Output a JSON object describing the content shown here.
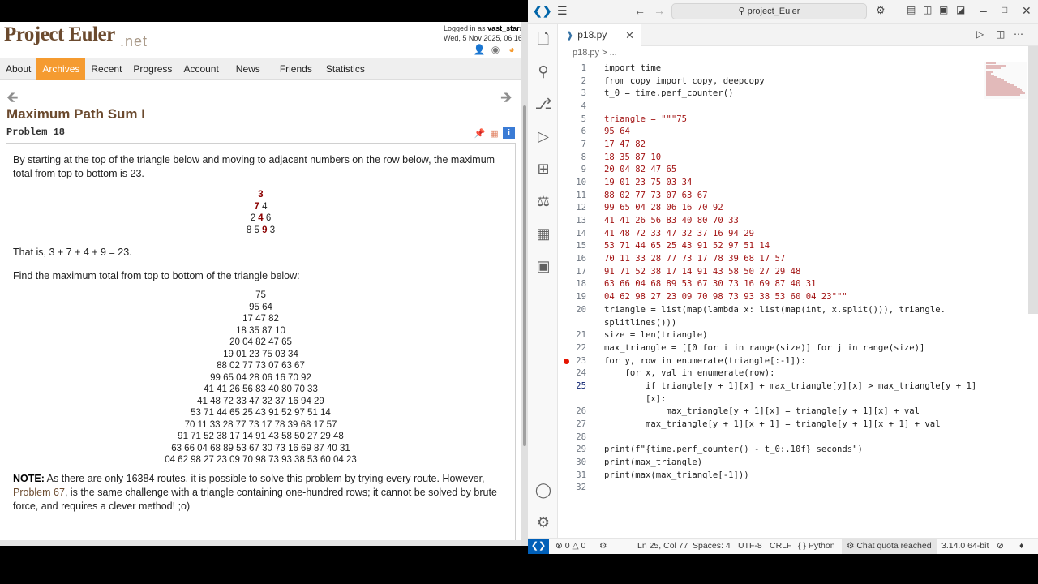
{
  "browser": {
    "logo": "Project Euler",
    "logo_suffix": ".net",
    "login_prefix": "Logged in as",
    "username": "vast_stars",
    "date": "Wed, 5 Nov 2025, 06:16",
    "nav": [
      "About",
      "Archives",
      "Recent",
      "Progress",
      "Account",
      "News",
      "Friends",
      "Statistics"
    ],
    "problem_title": "Maximum Path Sum I",
    "problem_number": "Problem 18",
    "intro": "By starting at the top of the triangle below and moving to adjacent numbers on the row below, the maximum total from top to bottom is 23.",
    "small_triangle": {
      "row1": "3",
      "row2_bold": "7",
      "row2_rest": " 4",
      "row3_a": "2 ",
      "row3_bold": "4",
      "row3_b": " 6",
      "row4_a": "8 5 ",
      "row4_bold": "9",
      "row4_b": " 3"
    },
    "that_is": "That is, 3 + 7 + 4 + 9 = 23.",
    "find_max": "Find the maximum total from top to bottom of the triangle below:",
    "big_triangle": [
      "75",
      "95 64",
      "17 47 82",
      "18 35 87 10",
      "20 04 82 47 65",
      "19 01 23 75 03 34",
      "88 02 77 73 07 63 67",
      "99 65 04 28 06 16 70 92",
      "41 41 26 56 83 40 80 70 33",
      "41 48 72 33 47 32 37 16 94 29",
      "53 71 44 65 25 43 91 52 97 51 14",
      "70 11 33 28 77 73 17 78 39 68 17 57",
      "91 71 52 38 17 14 91 43 58 50 27 29 48",
      "63 66 04 68 89 53 67 30 73 16 69 87 40 31",
      "04 62 98 27 23 09 70 98 73 93 38 53 60 04 23"
    ],
    "note_label": "NOTE:",
    "note_a": " As there are only 16384 routes, it is possible to solve this problem by trying every route. However, ",
    "note_link": "Problem 67",
    "note_b": ", is the same challenge with a triangle containing one-hundred rows; it cannot be solved by brute force, and requires a clever method! ;o)"
  },
  "vscode": {
    "search": "project_Euler",
    "tab": "p18.py",
    "tab_icon": "python-file-icon",
    "breadcrumb": "p18.py > ...",
    "lines": [
      {
        "n": "1"
      },
      {
        "n": "2"
      },
      {
        "n": "3"
      },
      {
        "n": "4"
      },
      {
        "n": "5"
      },
      {
        "n": "6"
      },
      {
        "n": "7"
      },
      {
        "n": "8"
      },
      {
        "n": "9"
      },
      {
        "n": "10"
      },
      {
        "n": "11"
      },
      {
        "n": "12"
      },
      {
        "n": "13"
      },
      {
        "n": "14"
      },
      {
        "n": "15"
      },
      {
        "n": "16"
      },
      {
        "n": "17"
      },
      {
        "n": "18"
      },
      {
        "n": "19"
      },
      {
        "n": "20"
      },
      {
        "n": "21"
      },
      {
        "n": "22"
      },
      {
        "n": "23"
      },
      {
        "n": "24"
      },
      {
        "n": "25"
      },
      {
        "n": "26"
      },
      {
        "n": "27"
      },
      {
        "n": "28"
      },
      {
        "n": "29"
      },
      {
        "n": "30"
      },
      {
        "n": "31"
      },
      {
        "n": "32"
      }
    ],
    "code": {
      "l1": "import time",
      "l2": "from copy import copy, deepcopy",
      "l3": "t_0 = time.perf_counter()",
      "l5": "triangle = \"\"\"75",
      "l6": "95 64",
      "l7": "17 47 82",
      "l8": "18 35 87 10",
      "l9": "20 04 82 47 65",
      "l10": "19 01 23 75 03 34",
      "l11": "88 02 77 73 07 63 67",
      "l12": "99 65 04 28 06 16 70 92",
      "l13": "41 41 26 56 83 40 80 70 33",
      "l14": "41 48 72 33 47 32 37 16 94 29",
      "l15": "53 71 44 65 25 43 91 52 97 51 14",
      "l16": "70 11 33 28 77 73 17 78 39 68 17 57",
      "l17": "91 71 52 38 17 14 91 43 58 50 27 29 48",
      "l18": "63 66 04 68 89 53 67 30 73 16 69 87 40 31",
      "l19": "04 62 98 27 23 09 70 98 73 93 38 53 60 04 23\"\"\"",
      "l20a": "triangle = list(map(lambda x: list(map(int, x.split())), triangle.",
      "l20b": "splitlines()))",
      "l21": "size = len(triangle)",
      "l22": "max_triangle = [[0 for i in range(size)] for j in range(size)]",
      "l23": "for y, row in enumerate(triangle[:-1]):",
      "l24": "    for x, val in enumerate(row):",
      "l25a": "        if triangle[y + 1][x] + max_triangle[y][x] > max_triangle[y + 1]",
      "l25b": "        [x]:",
      "l26": "            max_triangle[y + 1][x] = triangle[y + 1][x] + val",
      "l27": "        max_triangle[y + 1][x + 1] = triangle[y + 1][x + 1] + val",
      "l29": "print(f\"{time.perf_counter() - t_0:.10f} seconds\")",
      "l30": "print(max_triangle)",
      "l31": "print(max(max_triangle[-1]))"
    },
    "status": {
      "errors": "0",
      "warnings": "0",
      "position": "Ln 25, Col 77",
      "spaces": "Spaces: 4",
      "encoding": "UTF-8",
      "eol": "CRLF",
      "language": "Python",
      "chat": "Chat quota reached",
      "version": "3.14.0 64-bit"
    }
  }
}
